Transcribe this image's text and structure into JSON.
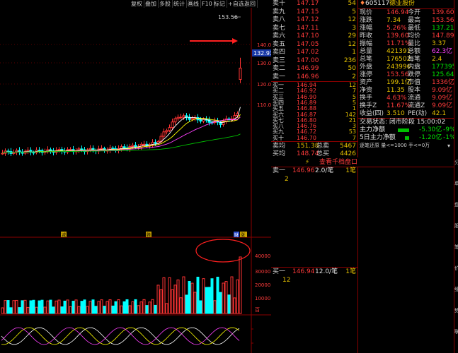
{
  "toolbar": {
    "buttons": [
      "复权",
      "叠加",
      "多股",
      "统计",
      "画线",
      "F10",
      "标记",
      "+自选",
      "返回"
    ]
  },
  "chart": {
    "peak_label": "153.56",
    "price_tag": "132.93",
    "right_axis_prices": [
      "140.0",
      "130.0",
      "120.0",
      "110.0"
    ],
    "markers": [
      "减",
      "腾",
      "财",
      "涨"
    ],
    "volume_axis": [
      "40000",
      "30000",
      "20000",
      "10000",
      "百"
    ],
    "colors": {
      "up": "#ff3333",
      "down": "#00ffff",
      "ma5": "#ffffff",
      "ma10": "#ffff00",
      "ma20": "#ff40ff",
      "ma60": "#00c000"
    }
  },
  "book": {
    "sell": [
      {
        "label": "卖十",
        "price": "147.17",
        "vol": "54"
      },
      {
        "label": "卖九",
        "price": "147.15",
        "vol": "5"
      },
      {
        "label": "卖八",
        "price": "147.12",
        "vol": "12"
      },
      {
        "label": "卖七",
        "price": "147.11",
        "vol": "3"
      },
      {
        "label": "卖六",
        "price": "147.10",
        "vol": "29"
      },
      {
        "label": "卖五",
        "price": "147.05",
        "vol": "12"
      },
      {
        "label": "卖四",
        "price": "147.02",
        "vol": "1"
      },
      {
        "label": "卖三",
        "price": "147.00",
        "vol": "236"
      },
      {
        "label": "卖二",
        "price": "146.99",
        "vol": "50"
      },
      {
        "label": "卖一",
        "price": "146.96",
        "vol": "2"
      }
    ],
    "buy": [
      {
        "label": "买一",
        "price": "146.94",
        "vol": "12"
      },
      {
        "label": "买二",
        "price": "146.92",
        "vol": "7"
      },
      {
        "label": "买三",
        "price": "146.90",
        "vol": "5"
      },
      {
        "label": "买四",
        "price": "146.89",
        "vol": "5"
      },
      {
        "label": "买五",
        "price": "146.88",
        "vol": "1"
      },
      {
        "label": "买六",
        "price": "146.87",
        "vol": "142"
      },
      {
        "label": "买七",
        "price": "146.80",
        "vol": "21"
      },
      {
        "label": "买八",
        "price": "146.76",
        "vol": "3"
      },
      {
        "label": "买九",
        "price": "146.72",
        "vol": "53"
      },
      {
        "label": "买十",
        "price": "146.70",
        "vol": "7"
      }
    ],
    "avg_sell": {
      "label": "卖均",
      "price": "151.38",
      "tlabel": "总卖",
      "vol": "5467"
    },
    "avg_buy": {
      "label": "买均",
      "price": "148.74",
      "tlabel": "总买",
      "vol": "4426"
    },
    "queue_button": "查看千档盘口",
    "queue_sell": {
      "label": "卖一",
      "price": "146.96",
      "qty": "2.0/笔",
      "count": "1笔",
      "sub": "2"
    },
    "queue_buy": {
      "label": "买一",
      "price": "146.94",
      "qty": "12.0/笔",
      "count": "1笔",
      "sub": "12"
    }
  },
  "info": {
    "code": "605117",
    "name": "德业股份",
    "rows": [
      [
        "现价",
        "146.94",
        "今开",
        "139.60"
      ],
      [
        "涨跌",
        "7.34",
        "最高",
        "153.56"
      ],
      [
        "涨幅",
        "5.26%",
        "最低",
        "137.21"
      ],
      [
        "昨收",
        "139.60",
        "均价",
        "147.89"
      ],
      [
        "振幅",
        "11.71%",
        "量比",
        "3.37"
      ],
      [
        "总量",
        "421391",
        "总额",
        "62.3亿"
      ],
      [
        "总笔",
        "176502",
        "每笔",
        "2.4"
      ],
      [
        "外盘",
        "243996",
        "内盘",
        "177395"
      ],
      [
        "涨停",
        "153.56",
        "跌停",
        "125.64"
      ],
      [
        "资产",
        "199.1亿",
        "市值",
        "1336亿"
      ],
      [
        "净资",
        "11.35",
        "股本",
        "9.09亿"
      ],
      [
        "换手",
        "4.63%",
        "流通",
        "9.09亿"
      ],
      [
        "换手Z",
        "11.67%",
        "流通Z",
        "9.09亿"
      ],
      [
        "收益(四)",
        "3.510",
        "PE(动)",
        "42.1"
      ]
    ],
    "trade_status": "交易状态: 闭市阶段 15:00:02",
    "flow": [
      {
        "label": "主力净额",
        "value": "-5.30亿",
        "pct": "-9%"
      },
      {
        "label": "5日主力净额",
        "value": "-1.20亿",
        "pct": "-1%"
      }
    ],
    "ticker_bar": "逐笔还原  量<=1000 手<=0万"
  },
  "side_tabs": [
    "分",
    "单",
    "盘",
    "股",
    "笔",
    "价",
    "细",
    "势",
    "联"
  ]
}
